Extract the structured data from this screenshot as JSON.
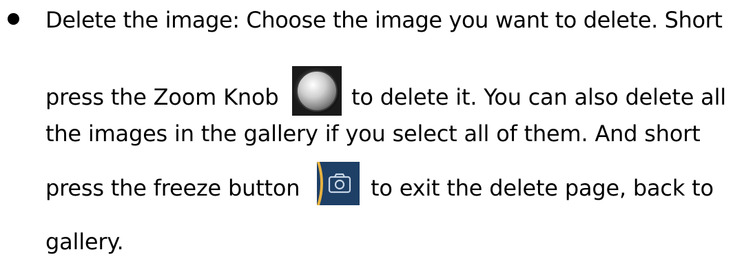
{
  "paragraph": {
    "line1": "Delete the image: Choose the image you want to delete. Short",
    "line2a": "press the Zoom Knob",
    "line2b": "to delete it. You can also delete all",
    "line3": "the images in the gallery if you select all of them. And short",
    "line4a": "press the freeze button",
    "line4b": "to exit the delete page, back to",
    "line5": "gallery."
  },
  "icons": {
    "zoom_knob": "zoom-knob-icon",
    "freeze_button": "camera-icon"
  },
  "colors": {
    "text": "#000000",
    "freeze_button_bg": "#1e3f66"
  }
}
